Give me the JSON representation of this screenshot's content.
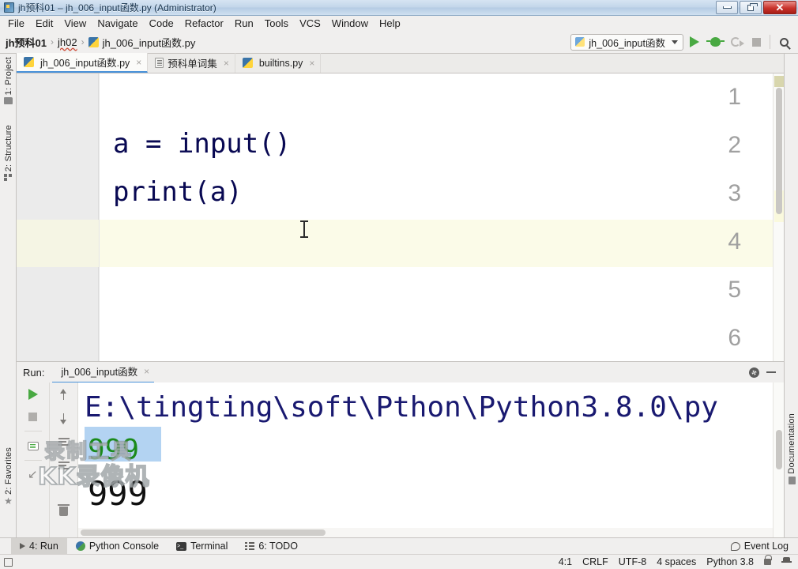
{
  "window": {
    "title": "jh预科01 – jh_006_input函数.py (Administrator)",
    "app_icon": "pycharm-icon",
    "minimize_label": "minimize",
    "restore_label": "restore",
    "close_label": "✕"
  },
  "menu": {
    "items": [
      "File",
      "Edit",
      "View",
      "Navigate",
      "Code",
      "Refactor",
      "Run",
      "Tools",
      "VCS",
      "Window",
      "Help"
    ]
  },
  "breadcrumb": {
    "project": "jh预科01",
    "folder": "jh02",
    "file": "jh_006_input函数.py",
    "separator": "›"
  },
  "toolbar": {
    "run_config": "jh_006_input函数",
    "run_icon": "run-icon",
    "debug_icon": "debug-icon",
    "coverage_icon": "coverage-icon",
    "stop_icon": "stop-icon",
    "search_icon": "search-icon"
  },
  "left_strip": {
    "project": "1: Project",
    "structure": "2: Structure",
    "favorites": "2: Favorites"
  },
  "right_strip": {
    "documentation": "Documentation"
  },
  "editor_tabs": [
    {
      "label": "jh_006_input函数.py",
      "icon": "python-file-icon",
      "active": true,
      "close": "×"
    },
    {
      "label": "预科单词集",
      "icon": "text-file-icon",
      "active": false,
      "close": "×"
    },
    {
      "label": "builtins.py",
      "icon": "python-file-icon",
      "active": false,
      "close": "×"
    }
  ],
  "editor": {
    "line_numbers": [
      "1",
      "2",
      "3",
      "4",
      "5",
      "6"
    ],
    "lines": [
      "",
      "a = input()",
      "print(a)",
      "",
      "",
      ""
    ],
    "current_line": 4,
    "caret_position": "4:1"
  },
  "run_panel": {
    "label": "Run:",
    "tab": "jh_006_input函数",
    "tab_icon": "python-config-icon",
    "tab_close": "×",
    "settings_icon": "gear-icon",
    "hide_icon": "minimize-icon",
    "toolbar": {
      "rerun": "rerun-icon",
      "stop": "stop-icon",
      "print": "print-icon",
      "up": "scroll-up-icon",
      "down": "scroll-down-icon",
      "soft_wrap": "soft-wrap-icon",
      "pin": "pin-icon",
      "trash": "clear-all-icon"
    },
    "console": {
      "command_line": "E:\\tingting\\soft\\Pthon\\Python3.8.0\\py",
      "user_input": "999",
      "program_output": "999"
    }
  },
  "watermark": {
    "line1": "录制工具",
    "line2": "KK录像机"
  },
  "bottom_tabs": [
    {
      "label": "4: Run",
      "icon": "run-icon",
      "active": true
    },
    {
      "label": "Python Console",
      "icon": "python-console-icon",
      "active": false
    },
    {
      "label": "Terminal",
      "icon": "terminal-icon",
      "active": false
    },
    {
      "label": "6: TODO",
      "icon": "todo-icon",
      "active": false
    }
  ],
  "event_log": {
    "label": "Event Log",
    "icon": "balloon-icon"
  },
  "status_bar": {
    "caret": "4:1",
    "line_separator": "CRLF",
    "encoding": "UTF-8",
    "indent": "4 spaces",
    "interpreter": "Python 3.8",
    "lock_icon": "lock-icon",
    "inspection_icon": "inspection-icon",
    "widget_icon": "widget-icon"
  },
  "colors": {
    "accent": "#4891d9",
    "keyword": "#080852",
    "console_path": "#191970",
    "console_input": "#1a8a1a",
    "selection": "#a6cbf0",
    "current_line": "#fbfbe8"
  }
}
